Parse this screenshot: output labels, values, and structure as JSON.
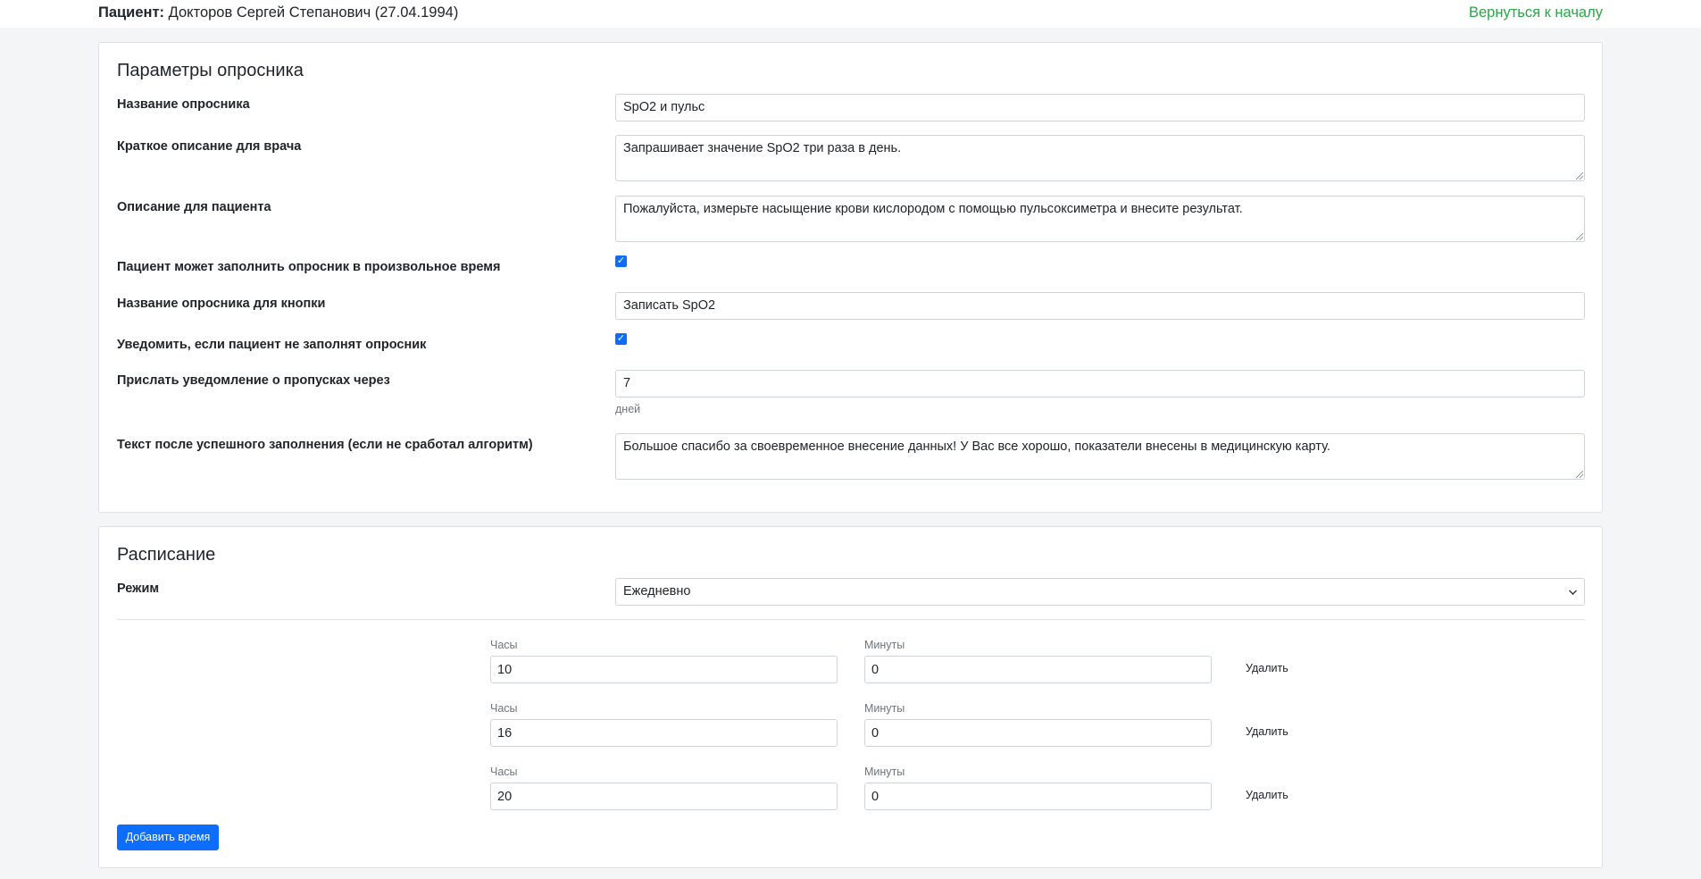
{
  "header": {
    "patient_label": "Пациент:",
    "patient_value": "Докторов Сергей Степанович (27.04.1994)",
    "back_link": "Вернуться к началу"
  },
  "params": {
    "title": "Параметры опросника",
    "name_label": "Название опросника",
    "name_value": "SpO2 и пульс",
    "doctor_desc_label": "Краткое описание для врача",
    "doctor_desc_value": "Запрашивает значение SpO2 три раза в день.",
    "patient_desc_label": "Описание для пациента",
    "patient_desc_value": "Пожалуйста, измерьте насыщение крови кислородом с помощью пульсоксиметра и внесите результат.",
    "anytime_label": "Пациент может заполнить опросник в произвольное время",
    "anytime_checked": true,
    "button_name_label": "Название опросника для кнопки",
    "button_name_value": "Записать SpO2",
    "notify_label": "Уведомить, если пациент не заполнят опросник",
    "notify_checked": true,
    "notify_after_label": "Прислать уведомление о пропусках через",
    "notify_after_value": "7",
    "notify_after_unit": "дней",
    "success_text_label": "Текст после успешного заполнения (если не сработал алгоритм)",
    "success_text_value": "Большое спасибо за своевременное внесение данных! У Вас все хорошо, показатели внесены в медицинскую карту."
  },
  "schedule": {
    "title": "Расписание",
    "mode_label": "Режим",
    "mode_value": "Ежедневно",
    "hours_label": "Часы",
    "minutes_label": "Минуты",
    "delete_label": "Удалить",
    "times": [
      {
        "hours": "10",
        "minutes": "0"
      },
      {
        "hours": "16",
        "minutes": "0"
      },
      {
        "hours": "20",
        "minutes": "0"
      }
    ],
    "add_button": "Добавить время"
  },
  "colors": {
    "accent": "#0d6efd",
    "link": "#28a745",
    "background": "#f4f5f7"
  }
}
